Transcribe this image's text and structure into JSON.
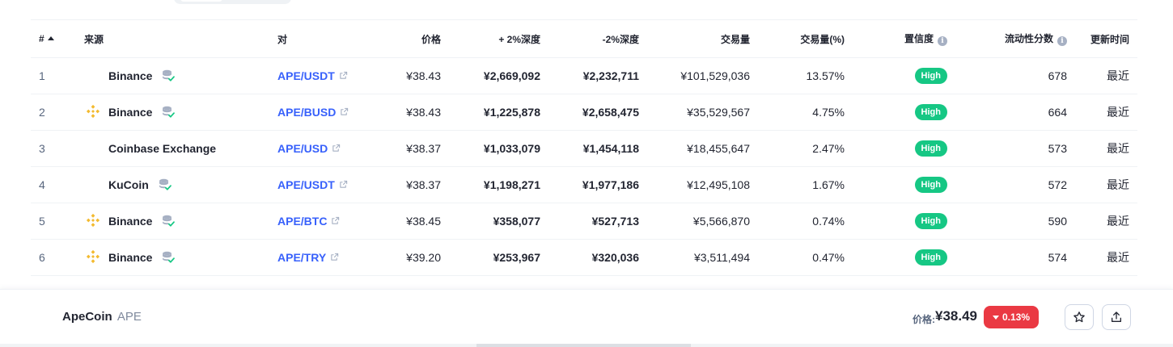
{
  "table": {
    "headers": {
      "rank": "#",
      "source": "来源",
      "pair": "对",
      "price": "价格",
      "depth_plus": "+ 2%深度",
      "depth_minus": "-2%深度",
      "volume": "交易量",
      "volume_pct": "交易量(%)",
      "confidence": "置信度",
      "liquidity": "流动性分数",
      "updated": "更新时间"
    },
    "rows": [
      {
        "rank": "1",
        "source": "Binance",
        "has_logo": false,
        "pair": "APE/USDT",
        "price": "¥38.43",
        "depth_plus": "¥2,669,092",
        "depth_minus": "¥2,232,711",
        "volume": "¥101,529,036",
        "volume_pct": "13.57%",
        "confidence": "High",
        "liquidity": "678",
        "updated": "最近"
      },
      {
        "rank": "2",
        "source": "Binance",
        "has_logo": true,
        "pair": "APE/BUSD",
        "price": "¥38.43",
        "depth_plus": "¥1,225,878",
        "depth_minus": "¥2,658,475",
        "volume": "¥35,529,567",
        "volume_pct": "4.75%",
        "confidence": "High",
        "liquidity": "664",
        "updated": "最近"
      },
      {
        "rank": "3",
        "source": "Coinbase Exchange",
        "has_logo": false,
        "pair": "APE/USD",
        "price": "¥38.37",
        "depth_plus": "¥1,033,079",
        "depth_minus": "¥1,454,118",
        "volume": "¥18,455,647",
        "volume_pct": "2.47%",
        "confidence": "High",
        "liquidity": "573",
        "updated": "最近"
      },
      {
        "rank": "4",
        "source": "KuCoin",
        "has_logo": false,
        "pair": "APE/USDT",
        "price": "¥38.37",
        "depth_plus": "¥1,198,271",
        "depth_minus": "¥1,977,186",
        "volume": "¥12,495,108",
        "volume_pct": "1.67%",
        "confidence": "High",
        "liquidity": "572",
        "updated": "最近"
      },
      {
        "rank": "5",
        "source": "Binance",
        "has_logo": true,
        "pair": "APE/BTC",
        "price": "¥38.45",
        "depth_plus": "¥358,077",
        "depth_minus": "¥527,713",
        "volume": "¥5,566,870",
        "volume_pct": "0.74%",
        "confidence": "High",
        "liquidity": "590",
        "updated": "最近"
      },
      {
        "rank": "6",
        "source": "Binance",
        "has_logo": true,
        "pair": "APE/TRY",
        "price": "¥39.20",
        "depth_plus": "¥253,967",
        "depth_minus": "¥320,036",
        "volume": "¥3,511,494",
        "volume_pct": "0.47%",
        "confidence": "High",
        "liquidity": "574",
        "updated": "最近"
      }
    ]
  },
  "bottom_bar": {
    "coin_name": "ApeCoin",
    "coin_symbol": "APE",
    "price_label": "价格:",
    "price_value": "¥38.49",
    "change": "0.13%",
    "change_direction": "down"
  },
  "colors": {
    "link": "#3861fb",
    "high_badge": "#16c784",
    "negative": "#ea3943",
    "binance_yellow": "#f3ba2f"
  },
  "icons": {
    "sort": "sort-up-icon",
    "info": "info-icon",
    "exchange_logo": "binance-logo-icon",
    "verified_reserve": "verified-database-icon",
    "external_link": "external-link-icon",
    "watchlist": "star-icon",
    "share": "share-icon"
  }
}
